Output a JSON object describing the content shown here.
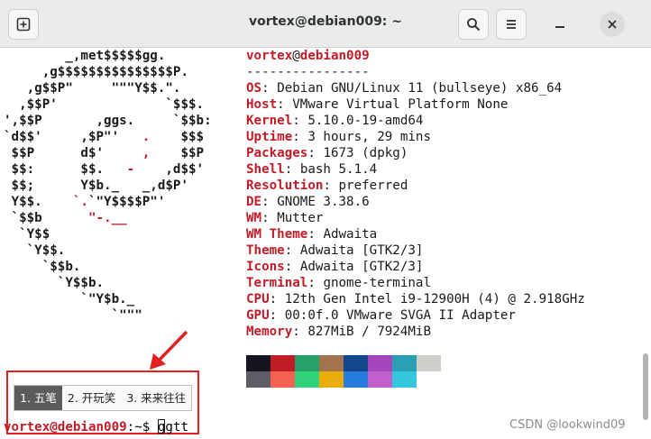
{
  "window": {
    "title": "vortex@debian009: ~",
    "icons": {
      "new_tab": "new-tab-icon",
      "search": "search-icon",
      "menu": "hamburger-menu-icon",
      "minimize": "minimize-icon",
      "close": "close-icon"
    }
  },
  "logo": {
    "lines": [
      [
        {
          "t": "        _,met$$$$$gg.",
          "c": "d"
        }
      ],
      [
        {
          "t": "     ,g$$$$$$$$$$$$$$$P.",
          "c": "d"
        }
      ],
      [
        {
          "t": "   ,g$$P\"     \"\"\"Y$$.\".",
          "c": "d"
        }
      ],
      [
        {
          "t": "  ,$$P'              `$$$.",
          "c": "d"
        }
      ],
      [
        {
          "t": "',$$P       ,ggs.     `$$b:",
          "c": "d"
        }
      ],
      [
        {
          "t": "`d$$'     ,$P\"'   ",
          "c": "d"
        },
        {
          "t": ".",
          "c": "r"
        },
        {
          "t": "    $$$",
          "c": "d"
        }
      ],
      [
        {
          "t": " $$P      d$'     ",
          "c": "d"
        },
        {
          "t": ",",
          "c": "r"
        },
        {
          "t": "    $$P",
          "c": "d"
        }
      ],
      [
        {
          "t": " $$:      $$.   ",
          "c": "d"
        },
        {
          "t": "-",
          "c": "r"
        },
        {
          "t": "    ,d$$'",
          "c": "d"
        }
      ],
      [
        {
          "t": " $$;      Y$b._   _,d$P'",
          "c": "d"
        }
      ],
      [
        {
          "t": " Y$$.    ",
          "c": "d"
        },
        {
          "t": "`.",
          "c": "r"
        },
        {
          "t": "`\"Y$$$$P\"'",
          "c": "d"
        }
      ],
      [
        {
          "t": " `$$b      ",
          "c": "d"
        },
        {
          "t": "\"-.__",
          "c": "r"
        }
      ],
      [
        {
          "t": "  `Y$$",
          "c": "d"
        }
      ],
      [
        {
          "t": "   `Y$$.",
          "c": "d"
        }
      ],
      [
        {
          "t": "     `$$b.",
          "c": "d"
        }
      ],
      [
        {
          "t": "       `Y$$b.",
          "c": "d"
        }
      ],
      [
        {
          "t": "          `\"Y$b._",
          "c": "d"
        }
      ],
      [
        {
          "t": "              `\"\"\"",
          "c": "d"
        }
      ]
    ]
  },
  "info": {
    "user": "vortex",
    "at": "@",
    "host": "debian009",
    "separator": "----------------",
    "rows": [
      {
        "key": "OS",
        "value": "Debian GNU/Linux 11 (bullseye) x86_64"
      },
      {
        "key": "Host",
        "value": "VMware Virtual Platform None"
      },
      {
        "key": "Kernel",
        "value": "5.10.0-19-amd64"
      },
      {
        "key": "Uptime",
        "value": "3 hours, 29 mins"
      },
      {
        "key": "Packages",
        "value": "1673 (dpkg)"
      },
      {
        "key": "Shell",
        "value": "bash 5.1.4"
      },
      {
        "key": "Resolution",
        "value": "preferred"
      },
      {
        "key": "DE",
        "value": "GNOME 3.38.6"
      },
      {
        "key": "WM",
        "value": "Mutter"
      },
      {
        "key": "WM Theme",
        "value": "Adwaita"
      },
      {
        "key": "Theme",
        "value": "Adwaita [GTK2/3]"
      },
      {
        "key": "Icons",
        "value": "Adwaita [GTK2/3]"
      },
      {
        "key": "Terminal",
        "value": "gnome-terminal"
      },
      {
        "key": "CPU",
        "value": "12th Gen Intel i9-12900H (4) @ 2.918GHz"
      },
      {
        "key": "GPU",
        "value": "00:0f.0 VMware SVGA II Adapter"
      },
      {
        "key": "Memory",
        "value": "827MiB / 7924MiB"
      }
    ],
    "colon": ": ",
    "palette_top": [
      "#171421",
      "#c01c28",
      "#26a269",
      "#a2734c",
      "#12488b",
      "#a347ba",
      "#2aa1b3",
      "#d0cfcc"
    ],
    "palette_bottom": [
      "#5e5c64",
      "#f66151",
      "#33d17a",
      "#e9ad0c",
      "#2a7bde",
      "#c061cb",
      "#33c7de",
      "#ffffff"
    ]
  },
  "ime": {
    "candidates": [
      "1. 五笔",
      "2. 开玩笑",
      "3. 来来往往"
    ],
    "selected_index": 0
  },
  "prompt": {
    "user_host": "vortex@debian009",
    "path": ":~",
    "symbol": "$ ",
    "input": "ggtt"
  },
  "annotation": {
    "box_color": "#e0211f",
    "arrow_color": "#e0211f"
  },
  "watermark": "CSDN @lookwind09"
}
